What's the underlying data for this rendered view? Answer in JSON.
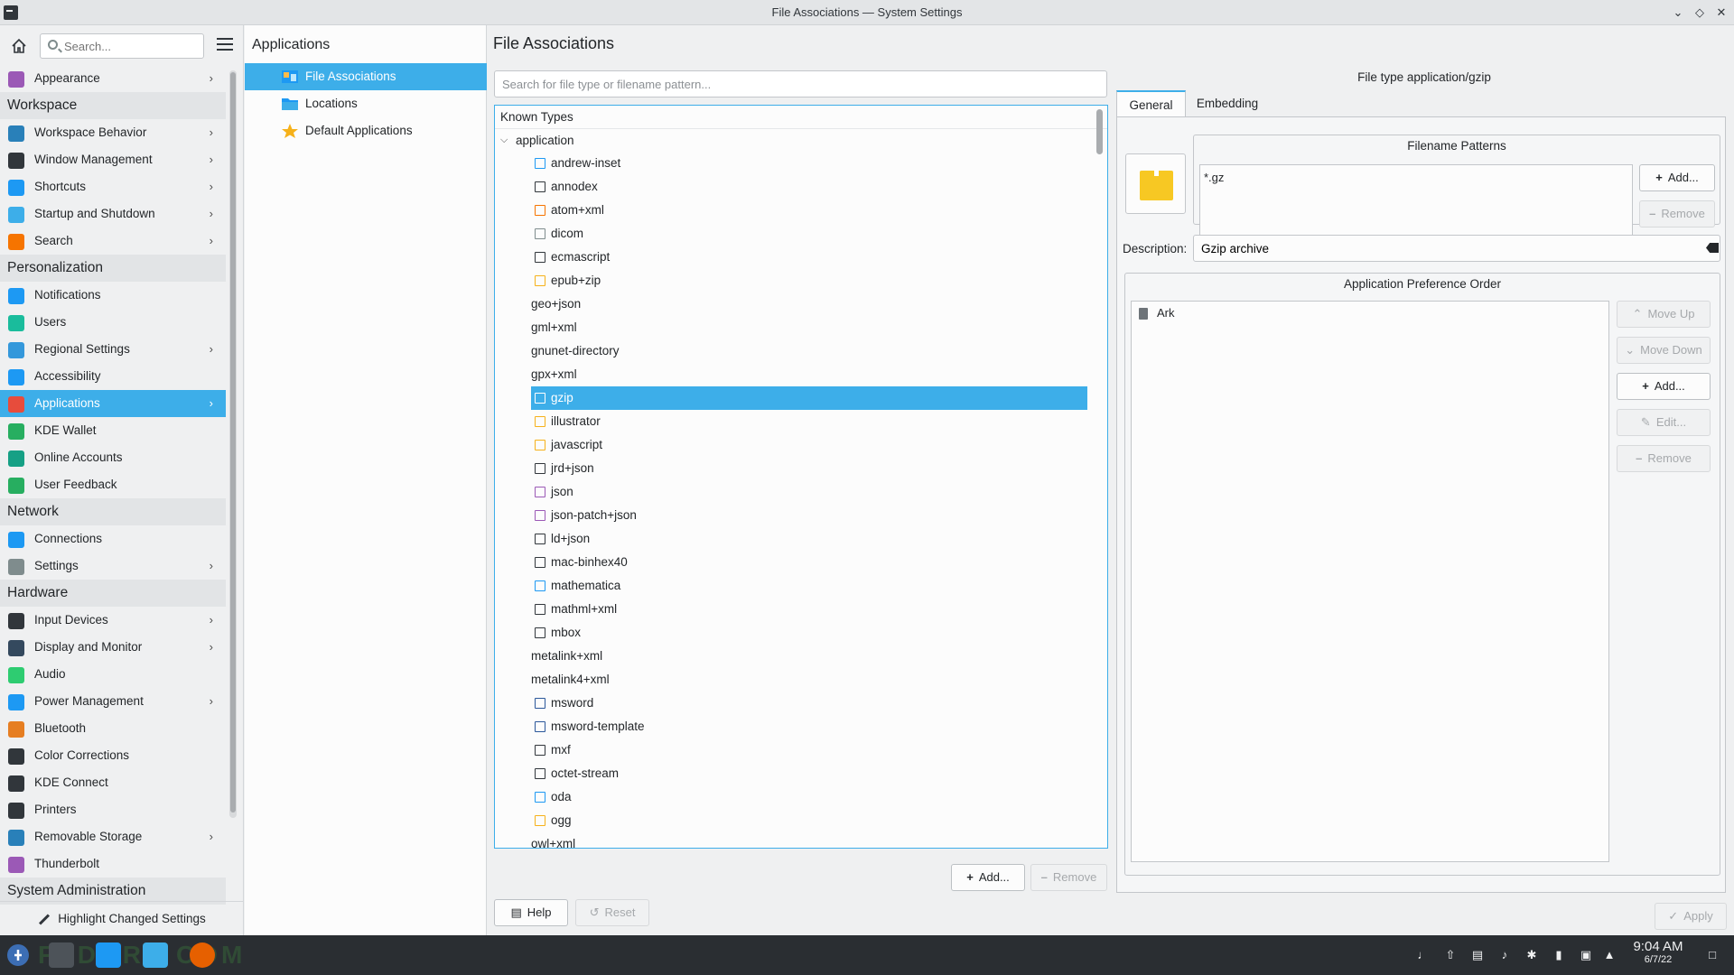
{
  "window": {
    "title": "File Associations — System Settings"
  },
  "sidebar": {
    "search_placeholder": "Search...",
    "top_item": {
      "label": "Appearance"
    },
    "categories": [
      {
        "label": "Workspace",
        "items": [
          {
            "label": "Workspace Behavior",
            "chevron": true
          },
          {
            "label": "Window Management",
            "chevron": true
          },
          {
            "label": "Shortcuts",
            "chevron": true
          },
          {
            "label": "Startup and Shutdown",
            "chevron": true
          },
          {
            "label": "Search",
            "chevron": true
          }
        ]
      },
      {
        "label": "Personalization",
        "items": [
          {
            "label": "Notifications"
          },
          {
            "label": "Users"
          },
          {
            "label": "Regional Settings",
            "chevron": true
          },
          {
            "label": "Accessibility"
          },
          {
            "label": "Applications",
            "chevron": true,
            "selected": true
          },
          {
            "label": "KDE Wallet"
          },
          {
            "label": "Online Accounts"
          },
          {
            "label": "User Feedback"
          }
        ]
      },
      {
        "label": "Network",
        "items": [
          {
            "label": "Connections"
          },
          {
            "label": "Settings",
            "chevron": true
          }
        ]
      },
      {
        "label": "Hardware",
        "items": [
          {
            "label": "Input Devices",
            "chevron": true
          },
          {
            "label": "Display and Monitor",
            "chevron": true
          },
          {
            "label": "Audio"
          },
          {
            "label": "Power Management",
            "chevron": true
          },
          {
            "label": "Bluetooth"
          },
          {
            "label": "Color Corrections"
          },
          {
            "label": "KDE Connect"
          },
          {
            "label": "Printers"
          },
          {
            "label": "Removable Storage",
            "chevron": true
          },
          {
            "label": "Thunderbolt"
          }
        ]
      },
      {
        "label": "System Administration",
        "items": []
      }
    ],
    "highlight_button": "Highlight Changed Settings"
  },
  "subpanel": {
    "heading": "Applications",
    "items": [
      {
        "label": "File Associations",
        "selected": true
      },
      {
        "label": "Locations"
      },
      {
        "label": "Default Applications"
      }
    ]
  },
  "main": {
    "title": "File Associations",
    "search_placeholder": "Search for file type or filename pattern...",
    "tree": {
      "header": "Known Types",
      "root": "application",
      "children": [
        {
          "label": "andrew-inset",
          "icon": true
        },
        {
          "label": "annodex",
          "icon": true
        },
        {
          "label": "atom+xml",
          "icon": true
        },
        {
          "label": "dicom",
          "icon": true
        },
        {
          "label": "ecmascript",
          "icon": true
        },
        {
          "label": "epub+zip",
          "icon": true
        },
        {
          "label": "geo+json",
          "icon": false
        },
        {
          "label": "gml+xml",
          "icon": false
        },
        {
          "label": "gnunet-directory",
          "icon": false
        },
        {
          "label": "gpx+xml",
          "icon": false
        },
        {
          "label": "gzip",
          "icon": true,
          "selected": true
        },
        {
          "label": "illustrator",
          "icon": true
        },
        {
          "label": "javascript",
          "icon": true
        },
        {
          "label": "jrd+json",
          "icon": true
        },
        {
          "label": "json",
          "icon": true
        },
        {
          "label": "json-patch+json",
          "icon": true
        },
        {
          "label": "ld+json",
          "icon": true
        },
        {
          "label": "mac-binhex40",
          "icon": true
        },
        {
          "label": "mathematica",
          "icon": true
        },
        {
          "label": "mathml+xml",
          "icon": true
        },
        {
          "label": "mbox",
          "icon": true
        },
        {
          "label": "metalink+xml",
          "icon": false
        },
        {
          "label": "metalink4+xml",
          "icon": false
        },
        {
          "label": "msword",
          "icon": true
        },
        {
          "label": "msword-template",
          "icon": true
        },
        {
          "label": "mxf",
          "icon": true
        },
        {
          "label": "octet-stream",
          "icon": true
        },
        {
          "label": "oda",
          "icon": true
        },
        {
          "label": "ogg",
          "icon": true
        },
        {
          "label": "owl+xml",
          "icon": false
        }
      ]
    },
    "add_button": "Add...",
    "remove_button": "Remove",
    "help_button": "Help",
    "reset_button": "Reset",
    "apply_button": "Apply"
  },
  "details": {
    "file_type_label": "File type application/gzip",
    "tabs": [
      "General",
      "Embedding"
    ],
    "active_tab": "General",
    "filename_patterns": {
      "title": "Filename Patterns",
      "patterns": [
        "*.gz"
      ],
      "add_button": "Add...",
      "remove_button": "Remove"
    },
    "description": {
      "label": "Description:",
      "value": "Gzip archive"
    },
    "app_preference": {
      "title": "Application Preference Order",
      "apps": [
        "Ark"
      ],
      "buttons": [
        "Move Up",
        "Move Down",
        "Add...",
        "Edit...",
        "Remove"
      ]
    }
  },
  "taskbar": {
    "watermark": "FEDORA COM",
    "time": "9:04 AM",
    "date": "6/7/22"
  },
  "colors": {
    "accent": "#3daee9",
    "taskbar": "#2a2e32",
    "archive_icon": "#f7c823"
  }
}
